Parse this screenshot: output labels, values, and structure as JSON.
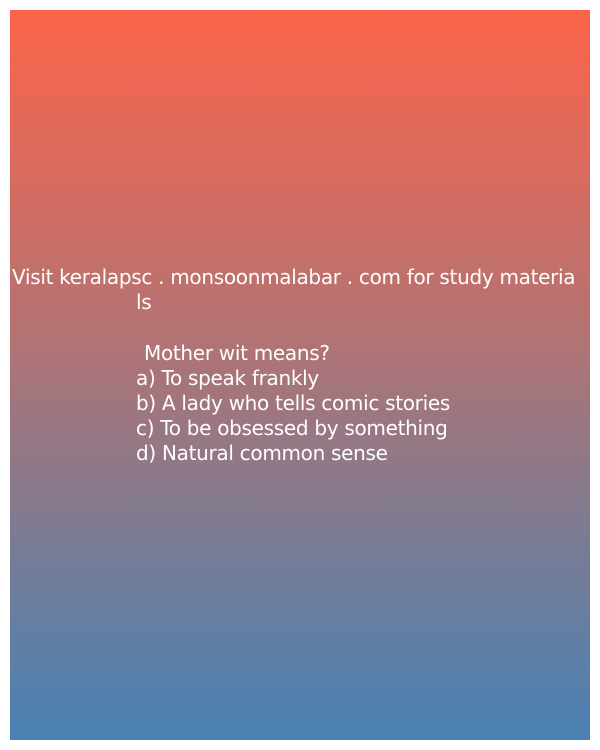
{
  "promo": {
    "line1": "Visit keralapsc . monsoonmalabar . com for study materia",
    "line2": "ls"
  },
  "question": {
    "text": "Mother wit means?",
    "options": [
      "a) To speak frankly",
      "b) A lady who tells comic stories",
      "c) To be obsessed by something",
      "d) Natural common sense"
    ]
  },
  "colors": {
    "gradient_top": "#fd644a",
    "gradient_bottom": "#4a81b4",
    "text": "#ffffff"
  }
}
